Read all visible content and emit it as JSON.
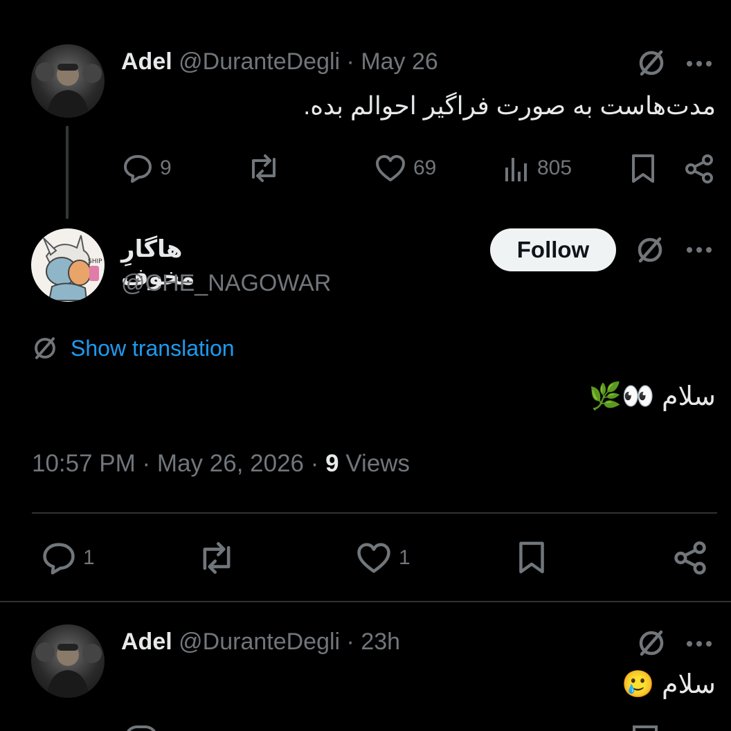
{
  "tweet1": {
    "name": "Adel",
    "handle": "@DuranteDegli",
    "sep": "·",
    "time": "May 26",
    "text": "مدت‌هاست به صورت فراگیر احوالم بده.",
    "stats": {
      "replies": "9",
      "likes": "69",
      "views": "805"
    }
  },
  "tweet2": {
    "name": "هاگارِ مخوف",
    "handle": "@CHE_NAGOWAR",
    "follow_label": "Follow",
    "show_translation": "Show translation",
    "text": "سلام 👀🌿",
    "timestamp": "10:57 PM · May 26, 2026 ·",
    "views_count": "9",
    "views_label": "Views",
    "stats": {
      "replies": "1",
      "likes": "1"
    }
  },
  "tweet3": {
    "name": "Adel",
    "handle": "@DuranteDegli",
    "sep": "·",
    "time": "23h",
    "text": "سلام 🥲"
  },
  "colors": {
    "background": "#000000",
    "primary_text": "#e7e9ea",
    "secondary_text": "#71767b",
    "link": "#1d9bf0",
    "divider": "#2f3336"
  }
}
